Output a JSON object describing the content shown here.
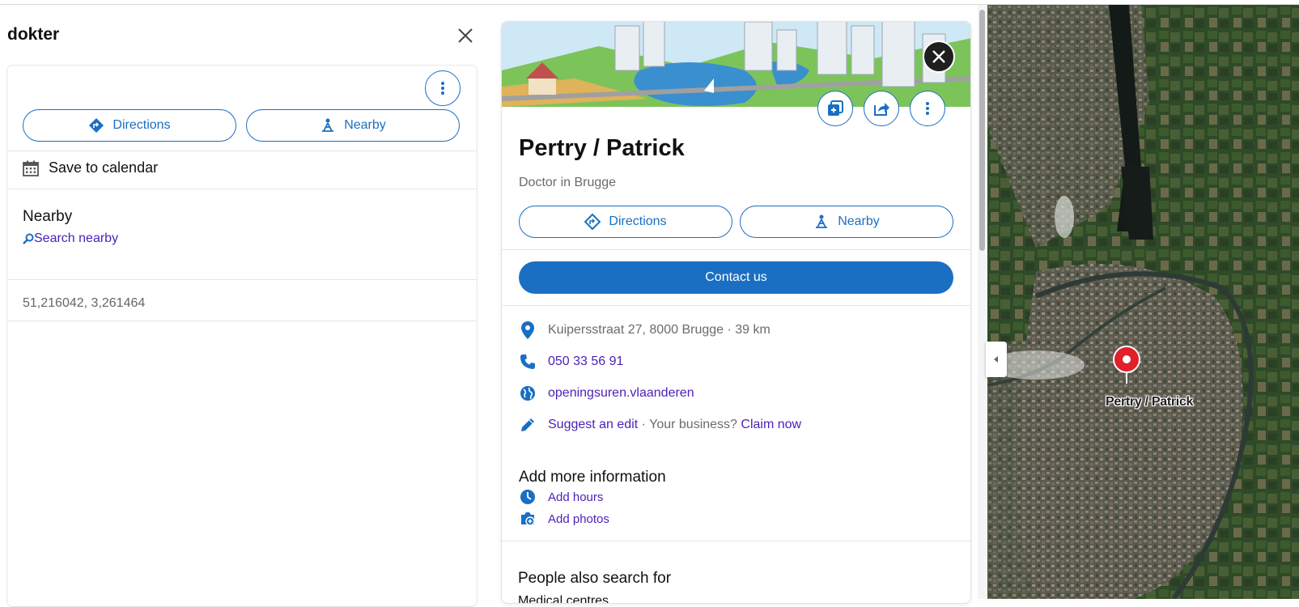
{
  "search": {
    "title": "dokter"
  },
  "left_panel": {
    "directions_label": "Directions",
    "nearby_label": "Nearby",
    "save_calendar_label": "Save to calendar",
    "nearby_heading": "Nearby",
    "search_nearby_label": "Search nearby",
    "coordinates": "51,216042, 3,261464"
  },
  "place": {
    "name": "Pertry / Patrick",
    "category": "Doctor in Brugge",
    "directions_label": "Directions",
    "nearby_label": "Nearby",
    "contact_label": "Contact us",
    "address": "Kuipersstraat 27, 8000 Brugge · 39 km",
    "phone": "050 33 56 91",
    "website": "openingsuren.vlaanderen",
    "suggest_edit": "Suggest an edit",
    "your_business": " · Your business? ",
    "claim_now": "Claim now",
    "add_more_heading": "Add more information",
    "add_hours": "Add hours",
    "add_photos": "Add photos",
    "people_also_search": "People also search for",
    "people_also_sub": "Medical centres"
  },
  "map": {
    "pin_label": "Pertry / Patrick"
  },
  "icons": {
    "close": "close-icon",
    "more": "more-vertical-icon",
    "directions": "directions-icon",
    "nearby": "nearby-icon",
    "calendar": "calendar-icon",
    "search": "search-icon",
    "location": "location-pin-icon",
    "phone": "phone-icon",
    "globe": "globe-icon",
    "edit": "pencil-icon",
    "clock": "clock-icon",
    "photo": "add-photo-icon",
    "save": "save-icon",
    "share": "share-icon",
    "collapse": "chevron-left-icon",
    "map_pin": "map-pin-icon"
  },
  "colors": {
    "accent": "#1a6fc2",
    "link": "#4b22b8",
    "pin": "#e0202a"
  }
}
